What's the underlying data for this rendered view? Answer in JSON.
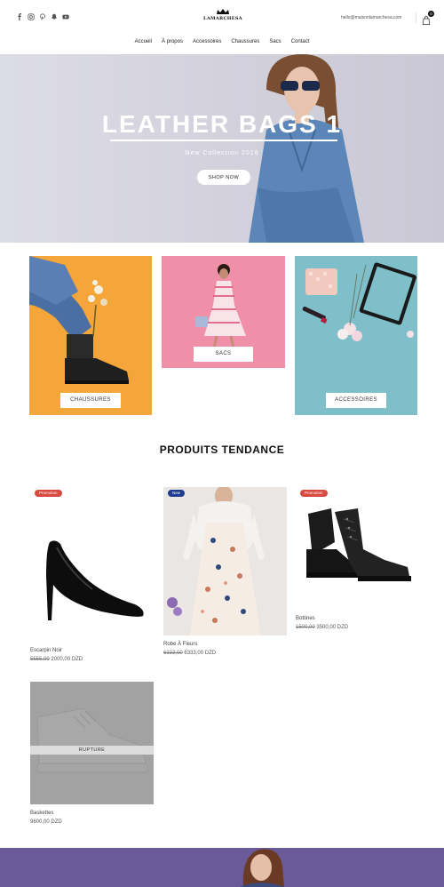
{
  "header": {
    "social_icons": [
      "facebook-icon",
      "instagram-icon",
      "pinterest-icon",
      "snapchat-icon",
      "youtube-icon"
    ],
    "logo_text": "LAMARCHESA",
    "email": "hello@maisonlamarchesa.com",
    "cart_count": "0"
  },
  "nav": {
    "items": [
      "Accueil",
      "À propos",
      "Accessoires",
      "Chaussures",
      "Sacs",
      "Contact"
    ]
  },
  "hero": {
    "title": "LEATHER BAGS 1",
    "subtitle": "New Collection 2018",
    "button": "SHOP NOW"
  },
  "categories": [
    {
      "label": "CHAUSSURES",
      "color": "#f4a63a"
    },
    {
      "label": "SACS",
      "color": "#f090a8"
    },
    {
      "label": "ACCESSOIRES",
      "color": "#7fbfca"
    }
  ],
  "trending": {
    "title": "PRODUITS TENDANCE"
  },
  "products": [
    {
      "name": "Escarpin Noir",
      "old_price": "5555,00",
      "price": "2000,00 DZD",
      "badge": "Promotion"
    },
    {
      "name": "Robe À Fleurs",
      "old_price": "6333,00",
      "price": "6333,00 DZD",
      "badge": "New"
    },
    {
      "name": "Bottines",
      "old_price": "1500,00",
      "price": "3500,00 DZD",
      "badge": "Promotion"
    },
    {
      "name": "Baskettes",
      "old_price": "",
      "price": "9600,00 DZD",
      "badge": "",
      "status": "RUPTURE"
    }
  ],
  "colors": {
    "promo": "#d84a3f",
    "new": "#1e3d8f",
    "banner": "#6a5a9a"
  }
}
